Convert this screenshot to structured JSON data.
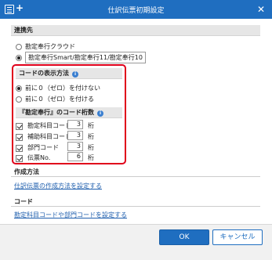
{
  "titlebar": {
    "title": "仕訳伝票初期設定",
    "plus": "+",
    "close": "✕"
  },
  "link_section": {
    "header": "連携先",
    "options": [
      {
        "label": "勘定奉行クラウド",
        "checked": false
      },
      {
        "label": "勘定奉行Smart/勘定奉行11/勘定奉行10",
        "checked": true
      }
    ]
  },
  "code_display": {
    "header": "コードの表示方法",
    "info_icon": "i",
    "options": [
      {
        "label": "前に０（ゼロ）を付けない",
        "checked": true
      },
      {
        "label": "前に０（ゼロ）を付ける",
        "checked": false
      }
    ]
  },
  "code_digits": {
    "header": "『勘定奉行』のコード桁数",
    "info_icon": "i",
    "unit": "桁",
    "rows": [
      {
        "label": "勘定科目コード",
        "value": "3",
        "checked": true
      },
      {
        "label": "補助科目コード",
        "value": "3",
        "checked": true
      },
      {
        "label": "部門コード",
        "value": "3",
        "checked": true
      },
      {
        "label": "伝票No.",
        "value": "6",
        "checked": true
      }
    ]
  },
  "creation": {
    "header": "作成方法",
    "link": "仕訳伝票の作成方法を設定する"
  },
  "code": {
    "header": "コード",
    "link": "勘定科目コードや部門コードを設定する"
  },
  "footer": {
    "ok": "OK",
    "cancel": "キャンセル"
  }
}
